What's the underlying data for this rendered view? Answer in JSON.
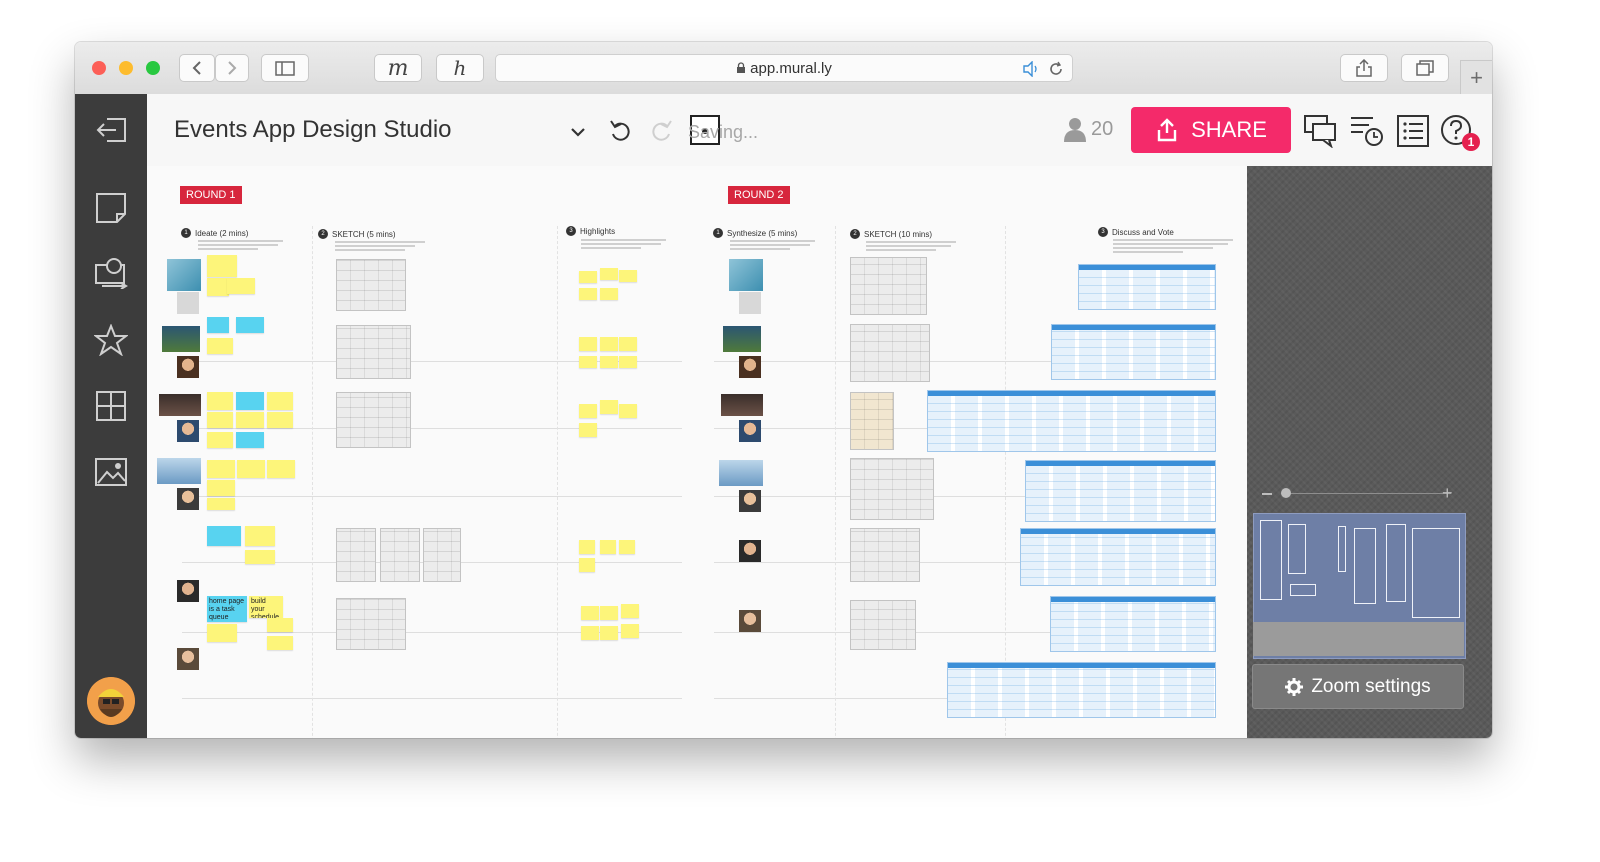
{
  "browser": {
    "url": "app.mural.ly",
    "back_icon": "chevron-left-icon",
    "forward_icon": "chevron-right-icon"
  },
  "header": {
    "board_title": "Events App Design Studio",
    "status": "Saving...",
    "participants_count": "20",
    "share_label": "SHARE",
    "notifications_badge": "1"
  },
  "rightpanel": {
    "zoom_settings_label": "Zoom settings"
  },
  "canvas": {
    "rounds": [
      {
        "label": "ROUND 1",
        "columns": [
          {
            "num": "1",
            "title": "Ideate (2 mins)"
          },
          {
            "num": "2",
            "title": "SKETCH (5 mins)"
          },
          {
            "num": "3",
            "title": "Highlights"
          }
        ]
      },
      {
        "label": "ROUND 2",
        "columns": [
          {
            "num": "1",
            "title": "Synthesize (5 mins)"
          },
          {
            "num": "2",
            "title": "SKETCH (10 mins)"
          },
          {
            "num": "3",
            "title": "Discuss and Vote"
          }
        ]
      }
    ],
    "readable_stickies": [
      {
        "text": "home page is a task queue (what to do next)"
      },
      {
        "text": "build your schedule"
      }
    ]
  },
  "colors": {
    "share": "#f42a6a",
    "round_tag": "#d7263d",
    "sticky_yellow": "#fdf57a",
    "sticky_blue": "#58d3f0",
    "leftbar": "#3c3c3c"
  }
}
